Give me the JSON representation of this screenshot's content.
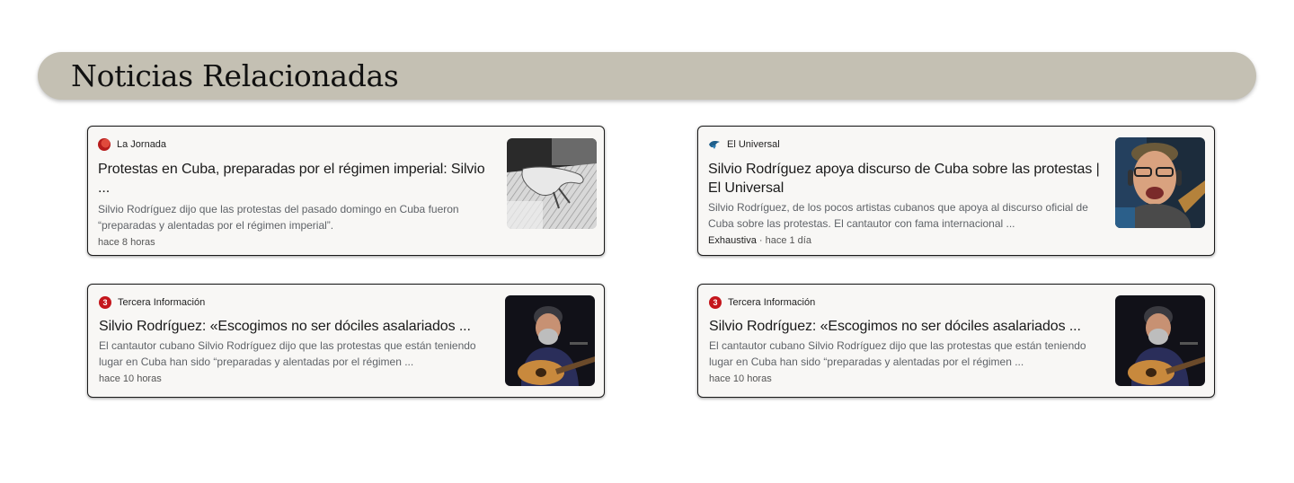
{
  "header": {
    "title": "Noticias Relacionadas"
  },
  "cards": [
    {
      "source": "La Jornada",
      "source_icon": "la-jornada-logo-icon",
      "title": "Protestas en Cuba, preparadas por el régimen imperial: Silvio ...",
      "snippet": "Silvio Rodríguez dijo que las protestas del pasado domingo en Cuba fueron “preparadas y alentadas por el régimen imperial”.",
      "meta_prefix": "",
      "time": "hace 8 horas"
    },
    {
      "source": "El Universal",
      "source_icon": "el-universal-logo-icon",
      "title": "Silvio Rodríguez apoya discurso de Cuba sobre las protestas | El Universal",
      "snippet": "Silvio Rodríguez, de los pocos artistas cubanos que apoya al discurso oficial de Cuba sobre las protestas. El cantautor con fama internacional ...",
      "meta_prefix": "Exhaustiva",
      "meta_sep": " · ",
      "time": "hace 1 día"
    },
    {
      "source": "Tercera Información",
      "source_icon": "tercera-informacion-logo-icon",
      "title": "Silvio Rodríguez: «Escogimos no ser dóciles asalariados ...",
      "snippet": "El cantautor cubano Silvio Rodríguez dijo que las protestas que están teniendo lugar en Cuba han sido “preparadas y alentadas por el régimen ...",
      "meta_prefix": "",
      "time": "hace 10 horas"
    },
    {
      "source": "Tercera Información",
      "source_icon": "tercera-informacion-logo-icon",
      "title": "Silvio Rodríguez: «Escogimos no ser dóciles asalariados ...",
      "snippet": "El cantautor cubano Silvio Rodríguez dijo que las protestas que están teniendo lugar en Cuba han sido “preparadas y alentadas por el régimen ...",
      "meta_prefix": "",
      "time": "hace 10 horas"
    }
  ],
  "colors": {
    "header_bg": "#c4c0b3",
    "card_bg": "#f8f7f5",
    "snippet": "#5f6368",
    "tercera_red": "#c4161c"
  },
  "tercera_logo_glyph": "3"
}
